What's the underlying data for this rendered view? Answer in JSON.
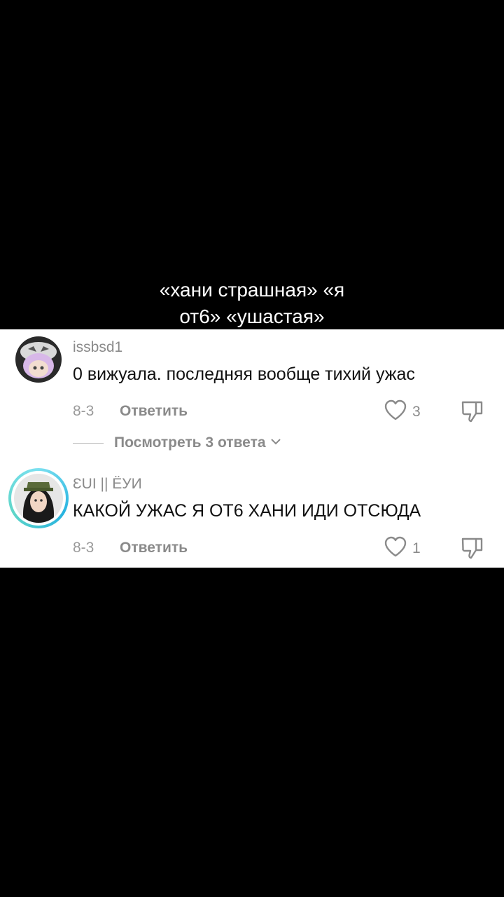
{
  "caption": {
    "line1": "«хани страшная» «я",
    "line2": "от6» «ушастая»"
  },
  "comments": [
    {
      "username": "issbsd1",
      "text": "0 вижуала. последняя вообще тихий ужас",
      "date": "8-3",
      "reply_label": "Ответить",
      "likes": "3",
      "view_replies": "Посмотреть 3 ответа"
    },
    {
      "username": "ƐUI || ЁУИ",
      "text": "КАКОЙ УЖАС Я ОТ6 ХАНИ ИДИ ОТСЮДА",
      "date": "8-3",
      "reply_label": "Ответить",
      "likes": "1"
    }
  ],
  "icons": {
    "like": "heart-outline-icon",
    "dislike": "thumbs-down-icon",
    "chevron": "chevron-down-icon"
  },
  "colors": {
    "muted_text": "#8a8a8a",
    "story_ring": "#35c8e6"
  }
}
